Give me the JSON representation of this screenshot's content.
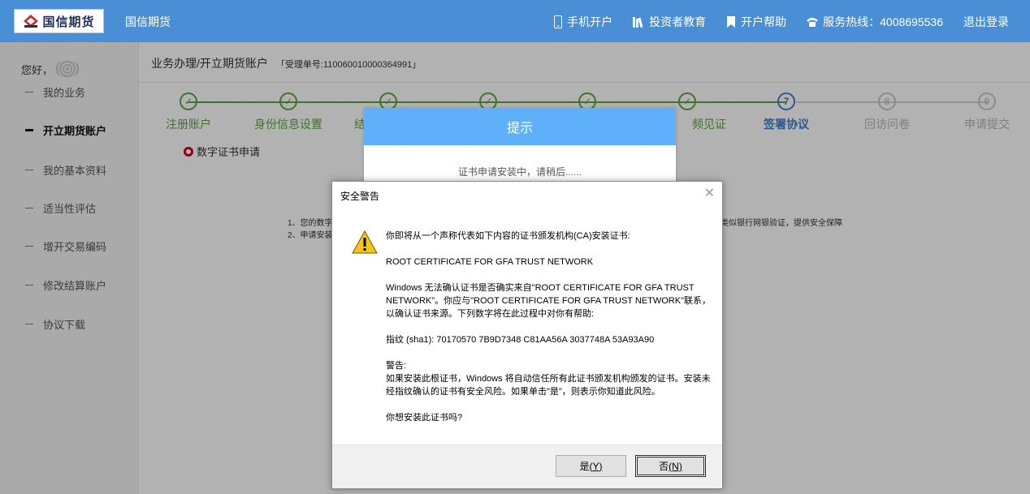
{
  "header": {
    "logo_text": "国信期货",
    "brand": "国信期货",
    "nav": [
      {
        "icon": "phone-icon",
        "label": "手机开户"
      },
      {
        "icon": "books-icon",
        "label": "投资者教育"
      },
      {
        "icon": "bookmark-icon",
        "label": "开户帮助"
      },
      {
        "icon": "telephone-icon",
        "label": "服务热线：4008695536"
      },
      {
        "icon": "",
        "label": "退出登录"
      }
    ]
  },
  "sidebar": {
    "greeting": "您好，",
    "items": [
      {
        "label": "我的业务"
      },
      {
        "label": "开立期货账户"
      },
      {
        "label": "我的基本资料"
      },
      {
        "label": "适当性评估"
      },
      {
        "label": "增开交易编码"
      },
      {
        "label": "修改结算账户"
      },
      {
        "label": "协议下载"
      }
    ]
  },
  "main": {
    "breadcrumb": "业务办理/开立期货账户",
    "serial": "「受理单号:110060010000364991」",
    "steps": [
      {
        "label": "注册账户",
        "state": "done",
        "num": ""
      },
      {
        "label": "身份信息设置",
        "state": "done",
        "num": ""
      },
      {
        "label": "结",
        "state": "done",
        "num": ""
      },
      {
        "label": "",
        "state": "done",
        "num": ""
      },
      {
        "label": "",
        "state": "done",
        "num": ""
      },
      {
        "label": "频见证",
        "state": "done",
        "num": ""
      },
      {
        "label": "签署协议",
        "state": "active",
        "num": "7"
      },
      {
        "label": "回访问卷",
        "state": "todo",
        "num": "8"
      },
      {
        "label": "申请提交",
        "state": "todo",
        "num": "9"
      }
    ],
    "section_title": "数字证书申请",
    "notice_1_head": "1、您的数字",
    "notice_1_tail": "书类似银行网银验证，提供安全保障",
    "notice_2_head": "2、申请安装"
  },
  "tip": {
    "title": "提示",
    "message": "证书申请安装中，请稍后......"
  },
  "security_warning": {
    "title": "安全警告",
    "close": "✕",
    "p1": "你即将从一个声称代表如下内容的证书颁发机构(CA)安装证书:",
    "p2": "ROOT CERTIFICATE FOR GFA TRUST NETWORK",
    "p3": "Windows 无法确认证书是否确实来自\"ROOT CERTIFICATE FOR GFA TRUST NETWORK\"。你应与\"ROOT CERTIFICATE FOR GFA TRUST NETWORK\"联系，以确认证书来源。下列数字将在此过程中对你有帮助:",
    "p4": "指纹 (sha1): 70170570 7B9D7348 C81AA56A 3037748A 53A93A90",
    "p5_title": "警告:",
    "p5_line1": "如果安装此根证书，Windows 将自动信任所有此证书颁发机构颁发的证书。安装未经指纹确认的证书有安全风险。如果单击\"是\"，则表示你知道此风险。",
    "p6": "你想安装此证书吗?",
    "yes": "是",
    "yes_key": "(Y)",
    "no": "否",
    "no_key": "(N)"
  }
}
